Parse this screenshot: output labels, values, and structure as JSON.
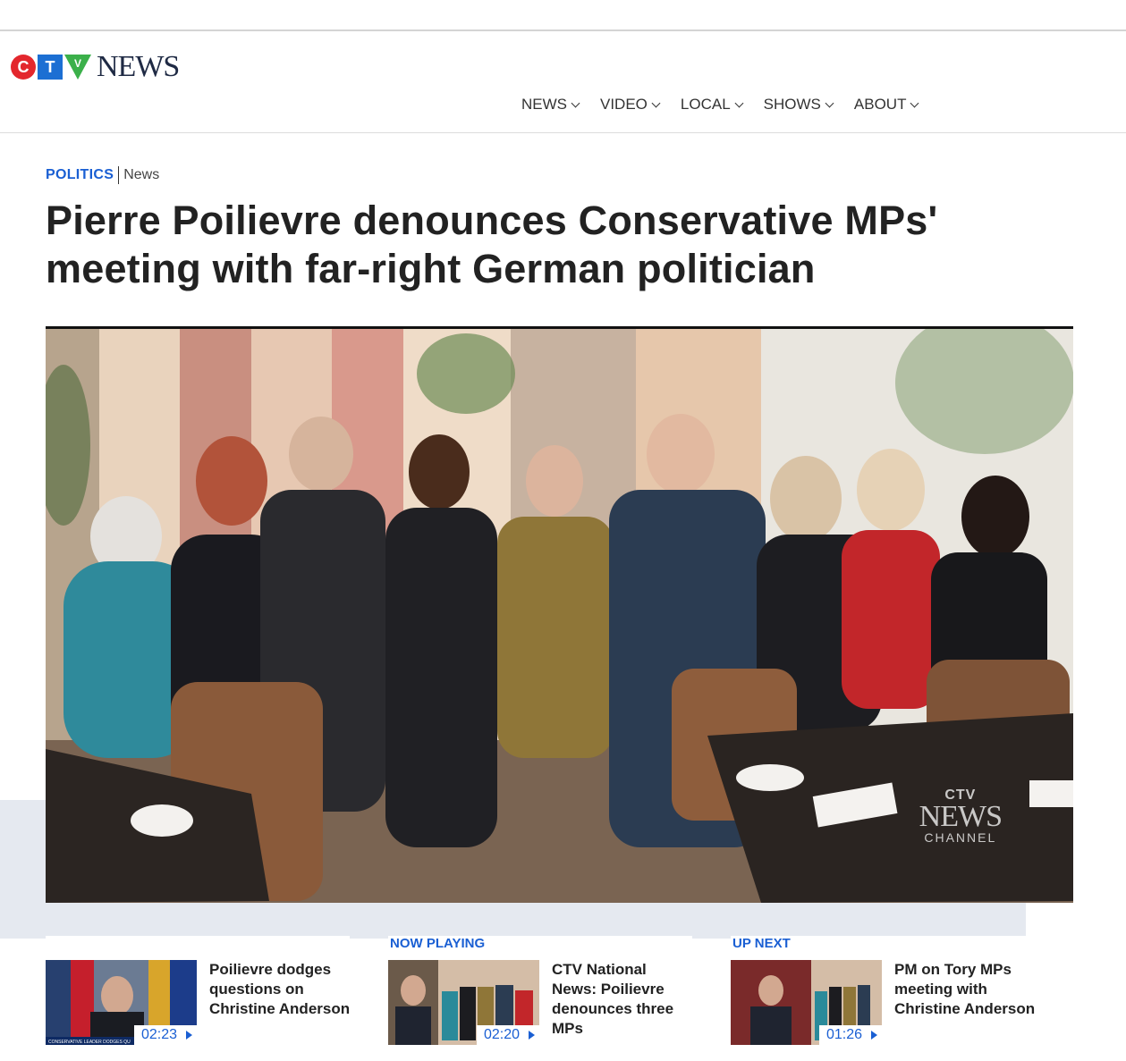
{
  "brand": {
    "logo_letters": [
      "C",
      "T",
      "V"
    ],
    "logo_word": "NEWS",
    "colors": {
      "c": "#e3272d",
      "t": "#1c6fd3",
      "v": "#3bb04a"
    }
  },
  "nav": {
    "items": [
      {
        "label": "NEWS"
      },
      {
        "label": "VIDEO"
      },
      {
        "label": "LOCAL"
      },
      {
        "label": "SHOWS"
      },
      {
        "label": "ABOUT"
      }
    ]
  },
  "article": {
    "section": "POLITICS",
    "subsection": "News",
    "headline": "Pierre Poilievre denounces Conservative MPs' meeting with far-right German politician",
    "hero_image": "group-photo-restaurant",
    "watermark": {
      "line1": "CTV",
      "line2": "NEWS",
      "line3": "CHANNEL"
    }
  },
  "videos": [
    {
      "label": "",
      "title": "Poilievre dodges questions on Christine Anderson",
      "duration": "02:23",
      "thumb_caption": "CONSERVATIVE LEADER DODGES QU"
    },
    {
      "label": "NOW PLAYING",
      "title": "CTV National News: Poilievre denounces three MPs",
      "duration": "02:20"
    },
    {
      "label": "UP NEXT",
      "title": "PM on Tory MPs meeting with Christine Anderson",
      "duration": "01:26"
    }
  ],
  "accent_color": "#1a5fd3"
}
